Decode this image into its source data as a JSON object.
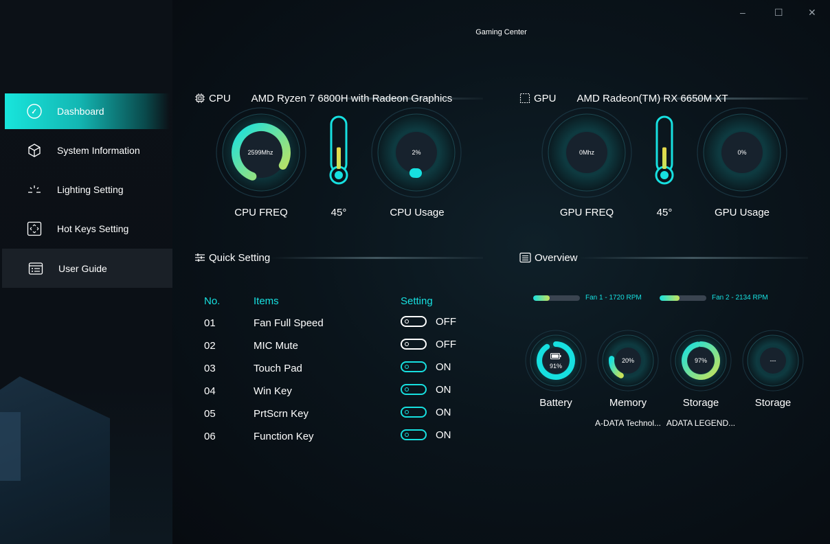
{
  "app": {
    "title": "Gaming Center"
  },
  "window_controls": {
    "minimize": "–",
    "maximize": "☐",
    "close": "✕"
  },
  "sidebar": {
    "items": [
      {
        "label": "Dashboard",
        "icon": "gauge-icon",
        "active": true
      },
      {
        "label": "System Information",
        "icon": "cube-icon"
      },
      {
        "label": "Lighting Setting",
        "icon": "light-rays-icon"
      },
      {
        "label": "Hot Keys Setting",
        "icon": "keypad-icon"
      },
      {
        "label": "User Guide",
        "icon": "guide-list-icon"
      }
    ]
  },
  "cpu": {
    "section_label": "CPU",
    "model": "AMD Ryzen 7 6800H with Radeon Graphics",
    "freq_value": "2599Mhz",
    "freq_fraction": 0.78,
    "freq_label": "CPU FREQ",
    "temp_value": "45°",
    "temp_fraction": 0.45,
    "usage_value": "2%",
    "usage_fraction": 0.02,
    "usage_label": "CPU Usage"
  },
  "gpu": {
    "section_label": "GPU",
    "model": "AMD Radeon(TM) RX 6650M XT",
    "freq_value": "0Mhz",
    "freq_label": "GPU FREQ",
    "temp_value": "45°",
    "temp_fraction": 0.45,
    "usage_value": "0%",
    "usage_label": "GPU Usage"
  },
  "quick_setting": {
    "title": "Quick Setting",
    "headers": {
      "no": "No.",
      "items": "Items",
      "setting": "Setting"
    },
    "rows": [
      {
        "no": "01",
        "item": "Fan Full Speed",
        "state": "OFF"
      },
      {
        "no": "02",
        "item": "MIC Mute",
        "state": "OFF"
      },
      {
        "no": "03",
        "item": "Touch Pad",
        "state": "ON"
      },
      {
        "no": "04",
        "item": "Win Key",
        "state": "ON"
      },
      {
        "no": "05",
        "item": "PrtScrn Key",
        "state": "ON"
      },
      {
        "no": "06",
        "item": "Function Key",
        "state": "ON"
      }
    ]
  },
  "overview": {
    "title": "Overview",
    "fans": [
      {
        "label": "Fan 1 - 1720 RPM",
        "fraction": 0.35
      },
      {
        "label": "Fan 2 - 2134 RPM",
        "fraction": 0.43
      }
    ],
    "gauges": [
      {
        "value": "91%",
        "fraction": 0.91,
        "label": "Battery",
        "sub": "",
        "icon": "battery-icon"
      },
      {
        "value": "20%",
        "fraction": 0.2,
        "label": "Memory",
        "sub": "A-DATA Technol..."
      },
      {
        "value": "97%",
        "fraction": 0.97,
        "label": "Storage",
        "sub": "ADATA LEGEND..."
      },
      {
        "value": "---",
        "fraction": 0,
        "label": "Storage",
        "sub": ""
      }
    ]
  },
  "colors": {
    "accent": "#17e0e0",
    "accent_yellow": "#c7e25a",
    "panel": "#1b2530"
  }
}
